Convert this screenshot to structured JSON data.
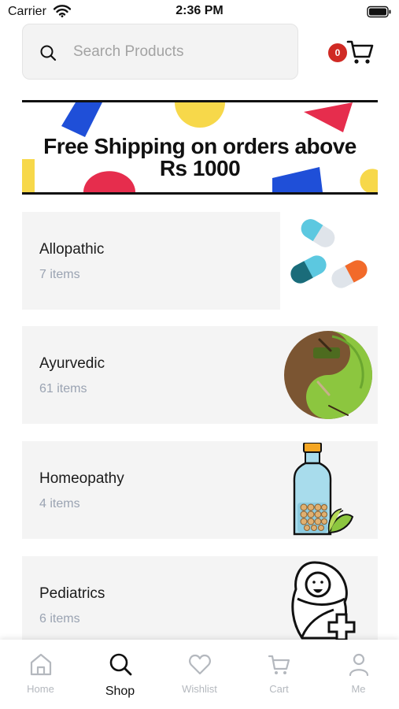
{
  "status_bar": {
    "carrier": "Carrier",
    "time": "2:36 PM"
  },
  "search": {
    "placeholder": "Search Products",
    "value": ""
  },
  "cart": {
    "count": "0"
  },
  "promo": {
    "line1": "Free Shipping on orders above",
    "line2": "Rs 1000"
  },
  "categories": [
    {
      "name": "Allopathic",
      "count": "7 items",
      "icon": "pills-icon"
    },
    {
      "name": "Ayurvedic",
      "count": "61 items",
      "icon": "ayurveda-mortar-icon"
    },
    {
      "name": "Homeopathy",
      "count": "4 items",
      "icon": "homeopathy-bottle-icon"
    },
    {
      "name": "Pediatrics",
      "count": "6 items",
      "icon": "swaddled-baby-icon"
    }
  ],
  "tabs": [
    {
      "label": "Home",
      "icon": "home-icon",
      "active": false
    },
    {
      "label": "Shop",
      "icon": "search-icon",
      "active": true
    },
    {
      "label": "Wishlist",
      "icon": "heart-icon",
      "active": false
    },
    {
      "label": "Cart",
      "icon": "cart-icon",
      "active": false
    },
    {
      "label": "Me",
      "icon": "user-icon",
      "active": false
    }
  ],
  "colors": {
    "badge": "#d02a24",
    "card_background": "#f4f4f4",
    "count_text": "#9aa3b2",
    "inactive_tab": "#b4b8be"
  }
}
